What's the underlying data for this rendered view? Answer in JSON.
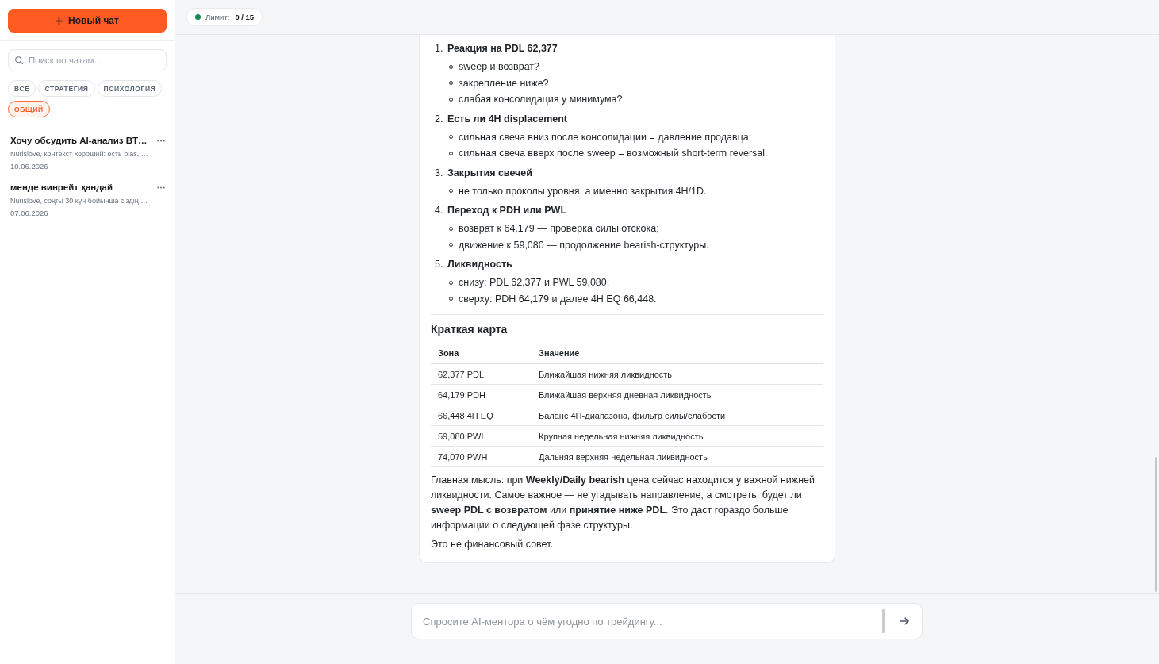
{
  "sidebar": {
    "new_chat_button": {
      "label": "Новый чат"
    },
    "search": {
      "placeholder": "Поиск по чатам..."
    },
    "filters": [
      {
        "label": "ВСЕ",
        "selected": false
      },
      {
        "label": "СТРАТЕГИЯ",
        "selected": false
      },
      {
        "label": "ПСИХОЛОГИЯ",
        "selected": false
      },
      {
        "label": "ОБЩИЙ",
        "selected": true
      }
    ],
    "chats": [
      {
        "title": "Хочу обсудить AI-анализ BT…",
        "preview": "Nurislove, контекст хороший: есть bias, …",
        "date": "10.06.2026"
      },
      {
        "title": "менде винрейт қандай",
        "preview": "Nurislove, соңғы 30 күн бойынша сіздің …",
        "date": "07.06.2026"
      }
    ]
  },
  "header": {
    "limit": {
      "label": "Лимит:",
      "value": "0 / 15"
    }
  },
  "message": {
    "steps": [
      {
        "number": "1.",
        "title": "Реакция на PDL 62,377",
        "points": [
          "sweep и возврат?",
          "закрепление ниже?",
          "слабая консолидация у минимума?"
        ]
      },
      {
        "number": "2.",
        "title": "Есть ли 4H displacement",
        "points": [
          "сильная свеча вниз после консолидации = давление продавца;",
          "сильная свеча вверх после sweep = возможный short-term reversal."
        ]
      },
      {
        "number": "3.",
        "title": "Закрытия свечей",
        "points": [
          "не только проколы уровня, а именно закрытия 4H/1D."
        ]
      },
      {
        "number": "4.",
        "title": "Переход к PDH или PWL",
        "points": [
          "возврат к 64,179 — проверка силы отскока;",
          "движение к 59,080 — продолжение bearish-структуры."
        ]
      },
      {
        "number": "5.",
        "title": "Ликвидность",
        "points": [
          "снизу: PDL 62,377 и PWL 59,080;",
          "сверху: PDH 64,179 и далее 4H EQ 66,448."
        ]
      }
    ],
    "section_title": "Краткая карта",
    "table": {
      "columns": [
        "Зона",
        "Значение"
      ],
      "rows": [
        [
          "62,377 PDL",
          "Ближайшая нижняя ликвидность"
        ],
        [
          "64,179 PDH",
          "Ближайшая верхняя дневная ликвидность"
        ],
        [
          "66,448 4H EQ",
          "Баланс 4H-диапазона, фильтр силы/слабости"
        ],
        [
          "59,080 PWL",
          "Крупная недельная нижняя ликвидность"
        ],
        [
          "74,070 PWH",
          "Дальняя верхняя недельная ликвидность"
        ]
      ]
    },
    "paragraphs": [
      "Главная мысль: при **Weekly/Daily bearish** цена сейчас находится у важной нижней ликвидности. Самое важное — не угадывать направление, а смотреть: будет ли **sweep PDL с возвратом** или **принятие ниже PDL**. Это даст гораздо больше информации о следующей фазе структуры.",
      "Это не финансовый совет."
    ]
  },
  "composer": {
    "placeholder": "Спросите AI-ментора о чём угодно по трейдингу..."
  }
}
